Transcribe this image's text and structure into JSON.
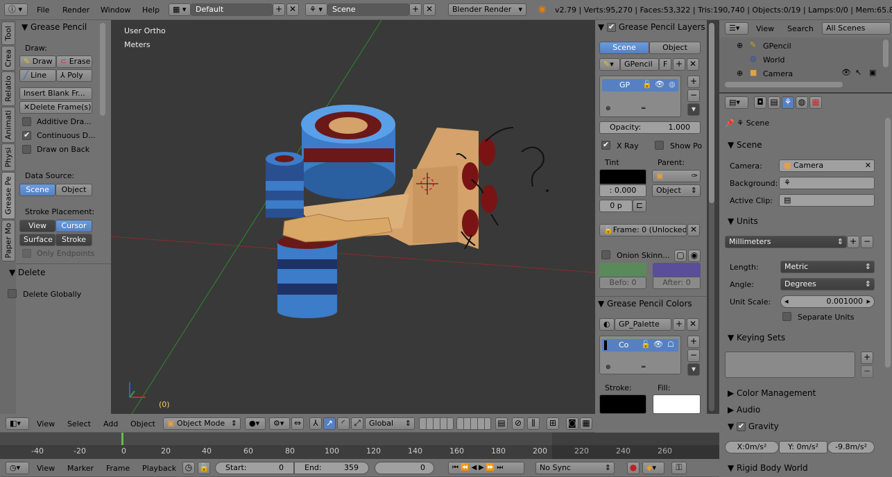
{
  "top_header": {
    "menus": [
      "File",
      "Render",
      "Window",
      "Help"
    ],
    "layout": "Default",
    "scene": "Scene",
    "engine": "Blender Render",
    "stats": "v2.79 | Verts:95,270 | Faces:53,322 | Tris:190,740 | Objects:0/19 | Lamps:0/0 | Mem:65.85M"
  },
  "tool_tabs": [
    "Tool",
    "Crea",
    "Relatio",
    "Animati",
    "Physi",
    "Grease Pe",
    "Paper Mo"
  ],
  "toolshelf": {
    "title": "Grease Pencil",
    "draw_label": "Draw:",
    "draw": "Draw",
    "erase": "Erase",
    "line": "Line",
    "poly": "Poly",
    "insert_blank": "Insert Blank Fr...",
    "delete_frames": "Delete Frame(s)",
    "additive": "Additive Dra...",
    "continuous": "Continuous D...",
    "draw_on_back": "Draw on Back",
    "data_source_label": "Data Source:",
    "ds_scene": "Scene",
    "ds_object": "Object",
    "stroke_placement_label": "Stroke Placement:",
    "sp_view": "View",
    "sp_cursor": "Cursor",
    "sp_surface": "Surface",
    "sp_stroke": "Stroke",
    "only_endpoints": "Only Endpoints",
    "delete_title": "Delete",
    "delete_globally": "Delete Globally"
  },
  "viewport": {
    "view_name": "User Ortho",
    "units": "Meters",
    "frame": "(0)"
  },
  "gp_layers_panel": {
    "title": "Grease Pencil Layers",
    "scene": "Scene",
    "object": "Object",
    "datablock": "GPencil",
    "fake": "F",
    "layer": "GP",
    "opacity_label": "Opacity:",
    "opacity": "1.000",
    "xray": "X Ray",
    "show_po": "Show Po",
    "tint": "Tint",
    "parent": "Parent:",
    "tint_value": ": 0.000",
    "parent_type": "Object",
    "thickness": "0 p",
    "frame_status": "Frame: 0 (Unlocked)",
    "onion": "Onion Skinn...",
    "before": "Befo: 0",
    "after": "After: 0"
  },
  "gp_colors_panel": {
    "title": "Grease Pencil Colors",
    "palette": "GP_Palette",
    "color": "Co",
    "stroke": "Stroke:",
    "fill": "Fill:"
  },
  "outliner": {
    "view": "View",
    "search": "Search",
    "filter": "All Scenes",
    "items": [
      "GPencil",
      "World",
      "Camera"
    ]
  },
  "properties": {
    "breadcrumb": "Scene",
    "scene_title": "Scene",
    "camera_label": "Camera:",
    "camera": "Camera",
    "background_label": "Background:",
    "active_clip_label": "Active Clip:",
    "units_title": "Units",
    "unit_preset": "Millimeters",
    "length_label": "Length:",
    "length": "Metric",
    "angle_label": "Angle:",
    "angle": "Degrees",
    "unit_scale_label": "Unit Scale:",
    "unit_scale": "0.001000",
    "separate_units": "Separate Units",
    "keying_sets": "Keying Sets",
    "color_management": "Color Management",
    "audio": "Audio",
    "gravity": "Gravity",
    "gx": "X:0m/s²",
    "gy": "Y: 0m/s²",
    "gz": "-9.8m/s²",
    "rigid_body": "Rigid Body World"
  },
  "view3d_header": {
    "view": "View",
    "select": "Select",
    "add": "Add",
    "object": "Object",
    "mode": "Object Mode",
    "orientation": "Global"
  },
  "timeline": {
    "ticks": [
      "-40",
      "-20",
      "0",
      "20",
      "40",
      "60",
      "80",
      "100",
      "120",
      "140",
      "160",
      "180",
      "200",
      "220",
      "240",
      "260"
    ],
    "view": "View",
    "marker": "Marker",
    "frame": "Frame",
    "playback": "Playback",
    "start": "Start:",
    "start_value": "0",
    "end": "End:",
    "end_value": "359",
    "current": "0",
    "sync": "No Sync"
  }
}
